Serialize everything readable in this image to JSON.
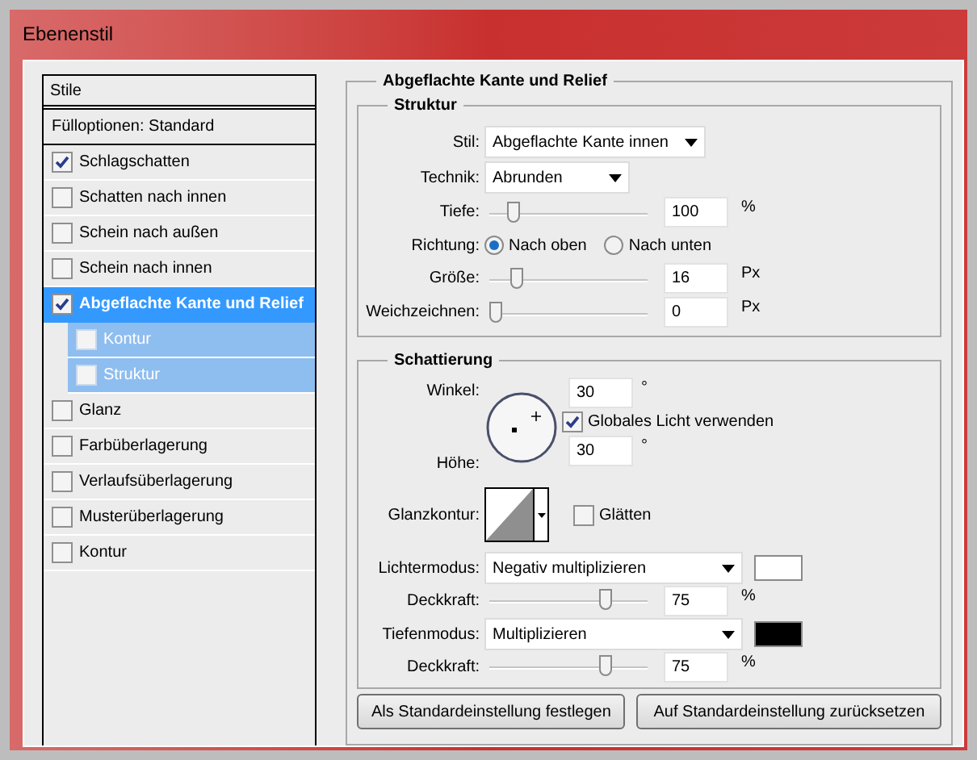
{
  "window": {
    "title": "Ebenenstil"
  },
  "styles_panel": {
    "header": "Stile",
    "items": [
      {
        "label": "Fülloptionen: Standard",
        "kind": "plain",
        "selected": false
      },
      {
        "label": "Schlagschatten",
        "kind": "checkbox",
        "checked": true,
        "selected": false
      },
      {
        "label": "Schatten nach innen",
        "kind": "checkbox",
        "checked": false,
        "selected": false
      },
      {
        "label": "Schein nach außen",
        "kind": "checkbox",
        "checked": false,
        "selected": false
      },
      {
        "label": "Schein nach innen",
        "kind": "checkbox",
        "checked": false,
        "selected": false
      },
      {
        "label": "Abgeflachte Kante und Relief",
        "kind": "checkbox",
        "checked": true,
        "selected": true,
        "children": [
          {
            "label": "Kontur",
            "checked": false
          },
          {
            "label": "Struktur",
            "checked": false
          }
        ]
      },
      {
        "label": "Glanz",
        "kind": "checkbox",
        "checked": false,
        "selected": false
      },
      {
        "label": "Farbüberlagerung",
        "kind": "checkbox",
        "checked": false,
        "selected": false
      },
      {
        "label": "Verlaufsüberlagerung",
        "kind": "checkbox",
        "checked": false,
        "selected": false
      },
      {
        "label": "Musterüberlagerung",
        "kind": "checkbox",
        "checked": false,
        "selected": false
      },
      {
        "label": "Kontur",
        "kind": "checkbox",
        "checked": false,
        "selected": false
      }
    ]
  },
  "bevel": {
    "title": "Abgeflachte Kante und Relief",
    "structure": {
      "title": "Struktur",
      "style": {
        "label": "Stil:",
        "value": "Abgeflachte Kante innen"
      },
      "technique": {
        "label": "Technik:",
        "value": "Abrunden"
      },
      "depth": {
        "label": "Tiefe:",
        "level": 0.12,
        "value": "100",
        "unit": "%"
      },
      "direction": {
        "label": "Richtung:",
        "options": [
          {
            "label": "Nach oben",
            "selected": true
          },
          {
            "label": "Nach unten",
            "selected": false
          }
        ]
      },
      "size": {
        "label": "Größe:",
        "level": 0.14,
        "value": "16",
        "unit": "Px"
      },
      "soften": {
        "label": "Weichzeichnen:",
        "level": 0,
        "value": "0",
        "unit": "Px"
      }
    },
    "shading": {
      "title": "Schattierung",
      "angle": {
        "label": "Winkel:",
        "value": "30",
        "unit": "°"
      },
      "global_light": {
        "label": "Globales Licht verwenden",
        "checked": true
      },
      "altitude": {
        "label": "Höhe:",
        "value": "30",
        "unit": "°"
      },
      "gloss_contour": {
        "label": "Glanzkontur:"
      },
      "anti_aliased": {
        "label": "Glätten",
        "checked": false
      },
      "highlight_mode": {
        "label": "Lichtermodus:",
        "value": "Negativ multiplizieren",
        "color": "#ffffff"
      },
      "highlight_opacity": {
        "label": "Deckkraft:",
        "level": 0.75,
        "value": "75",
        "unit": "%"
      },
      "shadow_mode": {
        "label": "Tiefenmodus:",
        "value": "Multiplizieren",
        "color": "#000000"
      },
      "shadow_opacity": {
        "label": "Deckkraft:",
        "level": 0.75,
        "value": "75",
        "unit": "%"
      }
    }
  },
  "buttons": [
    "Als Standardeinstellung festlegen",
    "Auf Standardeinstellung zurücksetzen"
  ]
}
